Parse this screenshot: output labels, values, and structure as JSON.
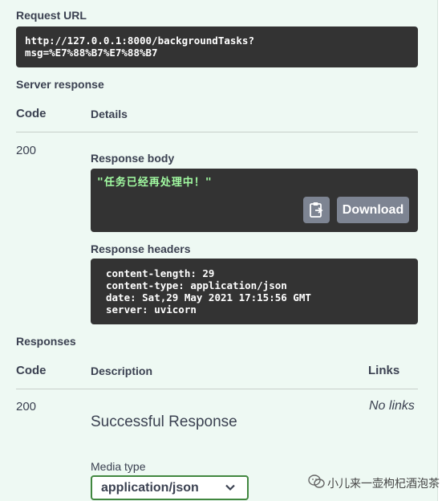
{
  "request_url": {
    "label": "Request URL",
    "line1": "http://127.0.0.1:8000/backgroundTasks?",
    "line2": "msg=%E7%88%B7%E7%88%B7"
  },
  "server_response": {
    "label": "Server response",
    "col_code": "Code",
    "col_details": "Details",
    "row": {
      "code": "200",
      "body_label": "Response body",
      "body": "\"任务已经再处理中！\"",
      "download_label": "Download",
      "headers_label": "Response headers",
      "headers": [
        "content-length: 29",
        "content-type: application/json",
        "date: Sat,29 May 2021 17:15:56 GMT",
        "server: uvicorn"
      ]
    }
  },
  "responses": {
    "label": "Responses",
    "col_code": "Code",
    "col_description": "Description",
    "col_links": "Links",
    "row": {
      "code": "200",
      "description": "Successful Response",
      "links": "No links",
      "media_type_label": "Media type",
      "media_type_value": "application/json"
    }
  },
  "watermark": {
    "text": "小儿来一壶枸杞酒泡茶"
  },
  "colors": {
    "background": "#eef9f3",
    "code_bg": "#333333",
    "body_text": "#a2fca2",
    "select_border": "#41873f"
  }
}
